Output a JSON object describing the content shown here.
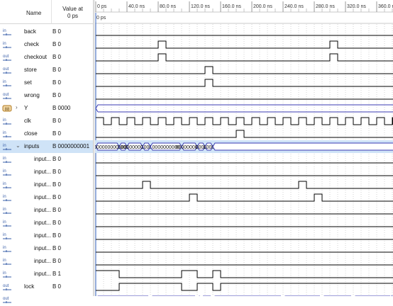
{
  "header": {
    "name_label": "Name",
    "value_label": "Value at",
    "value_time": "0 ps"
  },
  "timeline": {
    "cursor_label": "0 ps",
    "ticks": [
      "0 ps",
      "40.0 ns",
      "80.0 ns",
      "120.0 ns",
      "160.0 ns",
      "200.0 ns",
      "240.0 ns",
      "280.0 ns",
      "320.0 ns",
      "360.0 ns"
    ]
  },
  "signals": [
    {
      "icon": "in-icon",
      "name": "back",
      "value": "B 0",
      "wave": [
        [
          0,
          0
        ]
      ]
    },
    {
      "icon": "in-icon",
      "name": "check",
      "value": "B 0",
      "wave": [
        [
          0,
          0
        ],
        [
          80,
          1
        ],
        [
          90,
          0
        ],
        [
          300,
          1
        ],
        [
          310,
          0
        ]
      ]
    },
    {
      "icon": "out-icon",
      "name": "checkout",
      "value": "B 0",
      "wave": [
        [
          0,
          0
        ],
        [
          80,
          1
        ],
        [
          90,
          0
        ],
        [
          300,
          1
        ],
        [
          310,
          0
        ]
      ]
    },
    {
      "icon": "out-icon",
      "name": "store",
      "value": "B 0",
      "wave": [
        [
          0,
          0
        ],
        [
          140,
          1
        ],
        [
          150,
          0
        ]
      ]
    },
    {
      "icon": "in-icon",
      "name": "set",
      "value": "B 0",
      "wave": [
        [
          0,
          0
        ],
        [
          140,
          1
        ],
        [
          150,
          0
        ]
      ]
    },
    {
      "icon": "out-icon",
      "name": "wrong",
      "value": "B 0",
      "wave": [
        [
          0,
          0
        ]
      ]
    },
    {
      "icon": "bus-icon",
      "name": "Y",
      "value": "B 0000",
      "expander": "›",
      "bus": "empty"
    },
    {
      "icon": "in-icon",
      "name": "clk",
      "value": "B 0",
      "clock": true
    },
    {
      "icon": "in-icon",
      "name": "close",
      "value": "B 0",
      "wave": [
        [
          0,
          0
        ],
        [
          180,
          1
        ],
        [
          190,
          0
        ]
      ]
    },
    {
      "icon": "in-icon",
      "name": "inputs",
      "value": "B 0000000001",
      "expander": "⌄",
      "selected": true,
      "bus_segments": [
        {
          "start": 0,
          "end": 30,
          "label": "0000000001"
        },
        {
          "start": 30,
          "end": 40,
          "label": "0000"
        },
        {
          "start": 40,
          "end": 60,
          "label": "0000000000"
        },
        {
          "start": 60,
          "end": 70,
          "label": "1000"
        },
        {
          "start": 70,
          "end": 110,
          "label": "0000000000"
        },
        {
          "start": 110,
          "end": 130,
          "label": "0000000001"
        },
        {
          "start": 130,
          "end": 140,
          "label": "0000"
        },
        {
          "start": 140,
          "end": 150,
          "label": "1000"
        },
        {
          "start": 150,
          "end": 420,
          "label": ""
        }
      ]
    },
    {
      "icon": "in-icon",
      "name": "input...",
      "value": "B 0",
      "indent": true,
      "wave": [
        [
          0,
          0
        ]
      ]
    },
    {
      "icon": "in-icon",
      "name": "input...",
      "value": "B 0",
      "indent": true,
      "wave": [
        [
          0,
          0
        ]
      ]
    },
    {
      "icon": "in-icon",
      "name": "input...",
      "value": "B 0",
      "indent": true,
      "wave": [
        [
          0,
          0
        ],
        [
          60,
          1
        ],
        [
          70,
          0
        ],
        [
          260,
          1
        ],
        [
          270,
          0
        ]
      ]
    },
    {
      "icon": "in-icon",
      "name": "input...",
      "value": "B 0",
      "indent": true,
      "wave": [
        [
          0,
          0
        ],
        [
          120,
          1
        ],
        [
          130,
          0
        ],
        [
          280,
          1
        ],
        [
          290,
          0
        ]
      ]
    },
    {
      "icon": "in-icon",
      "name": "input...",
      "value": "B 0",
      "indent": true,
      "wave": [
        [
          0,
          0
        ]
      ]
    },
    {
      "icon": "in-icon",
      "name": "input...",
      "value": "B 0",
      "indent": true,
      "wave": [
        [
          0,
          0
        ]
      ]
    },
    {
      "icon": "in-icon",
      "name": "input...",
      "value": "B 0",
      "indent": true,
      "wave": [
        [
          0,
          0
        ]
      ]
    },
    {
      "icon": "in-icon",
      "name": "input...",
      "value": "B 0",
      "indent": true,
      "wave": [
        [
          0,
          0
        ]
      ]
    },
    {
      "icon": "in-icon",
      "name": "input...",
      "value": "B 0",
      "indent": true,
      "wave": [
        [
          0,
          0
        ]
      ]
    },
    {
      "icon": "in-icon",
      "name": "input...",
      "value": "B 1",
      "indent": true,
      "wave": [
        [
          0,
          1
        ],
        [
          30,
          0
        ],
        [
          110,
          1
        ],
        [
          130,
          0
        ],
        [
          150,
          1
        ],
        [
          160,
          0
        ]
      ]
    },
    {
      "icon": "out-icon",
      "name": "lock",
      "value": "B 0",
      "wave": [
        [
          0,
          0
        ],
        [
          30,
          1
        ],
        [
          110,
          0
        ],
        [
          130,
          1
        ],
        [
          150,
          0
        ],
        [
          160,
          1
        ]
      ]
    },
    {
      "icon": "out-icon",
      "name": "",
      "value": "",
      "bus": "partial"
    }
  ],
  "colors": {
    "wave": "#000000",
    "bus": "#3b3bb3",
    "selection": "#cfe3f7",
    "grid": "#b9b9b9"
  }
}
